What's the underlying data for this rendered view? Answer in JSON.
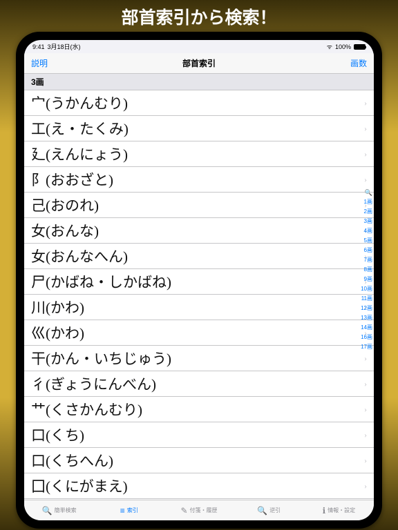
{
  "promo_title": "部首索引から検索！",
  "status": {
    "time": "9:41",
    "date": "3月18日(水)",
    "wifi": "100%"
  },
  "nav": {
    "left": "説明",
    "title": "部首索引",
    "right": "画数"
  },
  "section": "3画",
  "rows": [
    "宀(うかんむり)",
    "工(え・たくみ)",
    "廴(えんにょう)",
    "阝(おおざと)",
    "己(おのれ)",
    "女(おんな)",
    "女(おんなへん)",
    "尸(かばね・しかばね)",
    "川(かわ)",
    "巛(かわ)",
    "干(かん・いちじゅう)",
    "彳(ぎょうにんべん)",
    "艹(くさかんむり)",
    "口(くち)",
    "口(くちへん)",
    "囗(くにがまえ)"
  ],
  "index_bar": [
    "1画",
    "2画",
    "3画",
    "4画",
    "5画",
    "6画",
    "7画",
    "8画",
    "9画",
    "10画",
    "11画",
    "12画",
    "13画",
    "14画",
    "16画",
    "17画"
  ],
  "tabs": [
    {
      "icon": "🔍",
      "label": "簡単検索"
    },
    {
      "icon": "≡",
      "label": "索引"
    },
    {
      "icon": "✎",
      "label": "付箋・履歴"
    },
    {
      "icon": "🔍",
      "label": "逆引"
    },
    {
      "icon": "ℹ",
      "label": "情報・設定"
    }
  ]
}
